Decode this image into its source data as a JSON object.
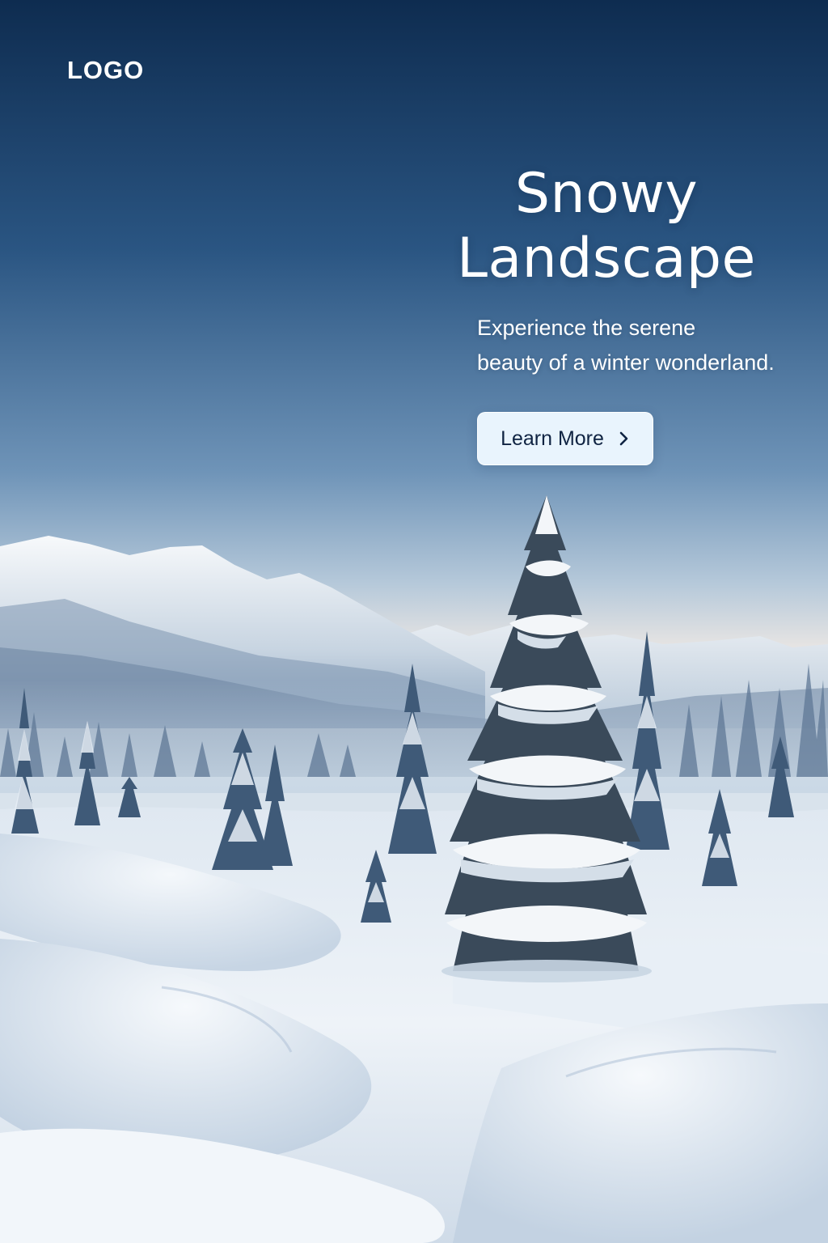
{
  "header": {
    "logo_text": "LOGO"
  },
  "hero": {
    "title_line1": "Snowy",
    "title_line2": "Landscape",
    "subtitle_line1": "Experience the serene",
    "subtitle_line2": "beauty of a winter wonderland.",
    "cta_label": "Learn More",
    "cta_icon": "chevron-right-icon"
  },
  "colors": {
    "sky_top": "#0e2c50",
    "sky_mid": "#5d86ad",
    "sky_horizon": "#dfe3e8",
    "snow": "#eef4fa",
    "button_bg": "#e9f4fd",
    "button_text": "#0f2342"
  }
}
